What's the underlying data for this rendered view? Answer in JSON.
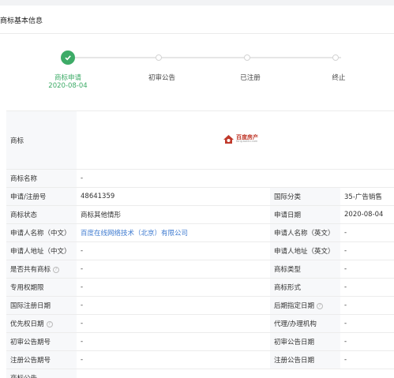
{
  "section_title": "商标基本信息",
  "steps": [
    {
      "label": "商标申请",
      "date": "2020-08-04",
      "done": true
    },
    {
      "label": "初审公告",
      "date": "",
      "done": false
    },
    {
      "label": "已注册",
      "date": "",
      "done": false
    },
    {
      "label": "终止",
      "date": "",
      "done": false
    }
  ],
  "mark": {
    "label": "商标",
    "logo_text": "百度房产",
    "logo_sub": "fang.baidu.com"
  },
  "rows": {
    "name": {
      "label": "商标名称",
      "value": "-"
    },
    "reg_no": {
      "label": "申请/注册号",
      "value": "48641359"
    },
    "intl_class": {
      "label": "国际分类",
      "value": "35-广告销售"
    },
    "status": {
      "label": "商标状态",
      "value": "商标其他情形"
    },
    "apply_date": {
      "label": "申请日期",
      "value": "2020-08-04"
    },
    "applicant_cn": {
      "label": "申请人名称（中文）",
      "value": "百度在线网络技术（北京）有限公司"
    },
    "applicant_en": {
      "label": "申请人名称（英文）",
      "value": "-"
    },
    "address_cn": {
      "label": "申请人地址（中文）",
      "value": "-"
    },
    "address_en": {
      "label": "申请人地址（英文）",
      "value": "-"
    },
    "shared": {
      "label": "是否共有商标",
      "value": "-"
    },
    "mark_type": {
      "label": "商标类型",
      "value": "-"
    },
    "exclusive_period": {
      "label": "专用权期限",
      "value": "-"
    },
    "mark_form": {
      "label": "商标形式",
      "value": "-"
    },
    "intl_reg_date": {
      "label": "国际注册日期",
      "value": "-"
    },
    "later_designation": {
      "label": "后期指定日期",
      "value": "-"
    },
    "priority_date": {
      "label": "优先权日期",
      "value": "-"
    },
    "agent": {
      "label": "代理/办理机构",
      "value": "-"
    },
    "prelim_no": {
      "label": "初审公告期号",
      "value": "-"
    },
    "prelim_date": {
      "label": "初审公告日期",
      "value": "-"
    },
    "reg_pub_no": {
      "label": "注册公告期号",
      "value": "-"
    },
    "reg_pub_date": {
      "label": "注册公告日期",
      "value": "-"
    },
    "partial": {
      "label": "商标公告"
    }
  }
}
